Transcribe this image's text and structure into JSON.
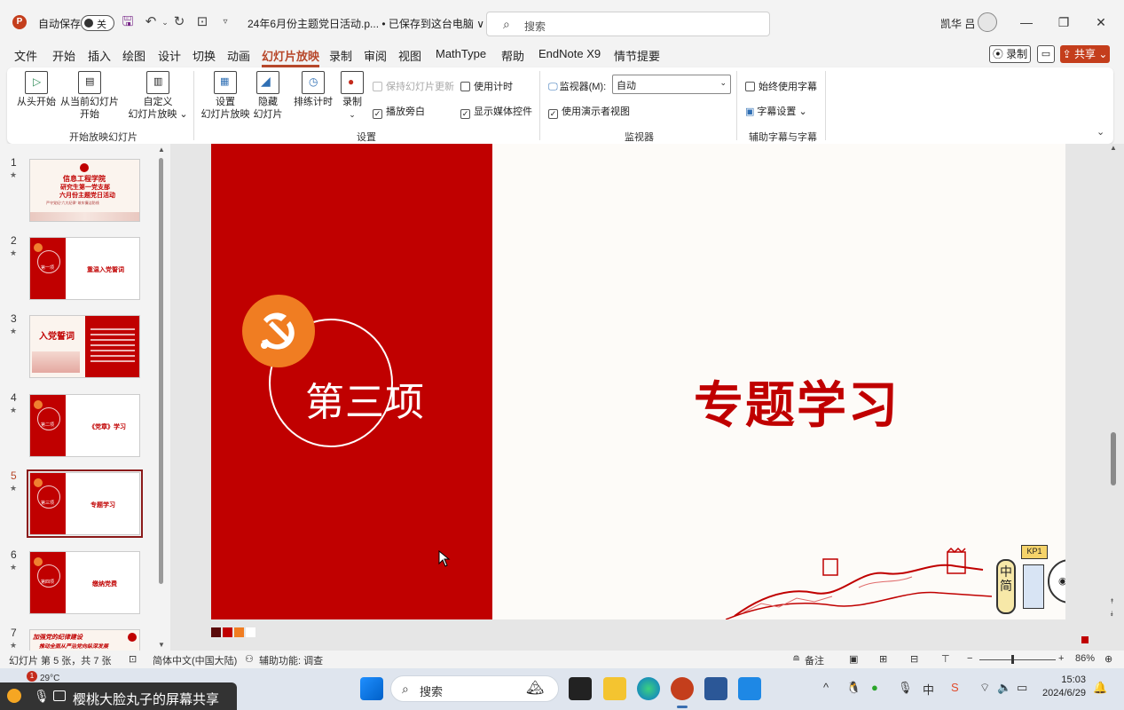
{
  "titlebar": {
    "autosave_label": "自动保存",
    "autosave_state": "关",
    "doc_title": "24年6月份主题党日活动.p... • 已保存到这台电脑 ∨",
    "search_placeholder": "搜索",
    "user_name": "凯华 吕"
  },
  "menu": [
    "文件",
    "开始",
    "插入",
    "绘图",
    "设计",
    "切换",
    "动画",
    "幻灯片放映",
    "录制",
    "审阅",
    "视图",
    "MathType",
    "帮助",
    "EndNote X9",
    "情节提要"
  ],
  "menu_active": "幻灯片放映",
  "menu_right": {
    "record": "录制",
    "share": "共享"
  },
  "ribbon": {
    "start_group": {
      "from_beginning": "从头开始",
      "from_current": "从当前幻灯片",
      "from_current_2": "开始",
      "custom": "自定义",
      "custom_2": "幻灯片放映 ⌄",
      "label": "开始放映幻灯片"
    },
    "setup_group": {
      "setup": "设置",
      "setup_2": "幻灯片放映",
      "hide": "隐藏",
      "hide_2": "幻灯片",
      "rehearse": "排练计时",
      "record": "录制",
      "keep_updated": "保持幻灯片更新",
      "use_timings": "使用计时",
      "play_narrations": "播放旁白",
      "show_media_controls": "显示媒体控件",
      "label": "设置"
    },
    "monitor_group": {
      "monitor_label": "监视器(M):",
      "monitor_value": "自动",
      "presenter_view": "使用演示者视图",
      "label": "监视器"
    },
    "captions_group": {
      "always_subtitles": "始终使用字幕",
      "subtitle_settings": "字幕设置 ⌄",
      "label": "辅助字幕与字幕"
    }
  },
  "slides": [
    {
      "num": "1",
      "title": "信息工程学院",
      "sub1": "研究生第一党支部",
      "sub2": "六月份主题党日活动",
      "sub3": "严守党纪“六大纪律”    筑牢廉洁防线"
    },
    {
      "num": "2",
      "item": "第一项",
      "title": "重温入党誓词"
    },
    {
      "num": "3",
      "title": "入党誓词"
    },
    {
      "num": "4",
      "item": "第二项",
      "title": "《党章》学习"
    },
    {
      "num": "5",
      "item": "第三项",
      "title": "专题学习"
    },
    {
      "num": "6",
      "item": "第四项",
      "title": "缴纳党费"
    },
    {
      "num": "7",
      "line1": "加强党的纪律建设",
      "line2": "推动全面从严治党向纵深发展"
    }
  ],
  "selected_slide": "5",
  "current_slide": {
    "item_label": "第三项",
    "title": "专题学习",
    "mascot_sign": "KP1",
    "mascot_text": "中简"
  },
  "statusbar": {
    "slide_info": "幻灯片 第 5 张，共 7 张",
    "language": "简体中文(中国大陆)",
    "accessibility": "辅助功能: 调查",
    "notes": "备注",
    "zoom": "86%"
  },
  "taskbar": {
    "temperature": "29°C",
    "badge": "1",
    "share_text": "樱桃大脸丸子的屏幕共享",
    "search": "搜索",
    "time": "15:03",
    "date": "2024/6/29"
  },
  "colors": {
    "accent": "#b7472a",
    "slide_red": "#c00000",
    "emblem_orange": "#f07d22",
    "share_button": "#c43e1c"
  }
}
